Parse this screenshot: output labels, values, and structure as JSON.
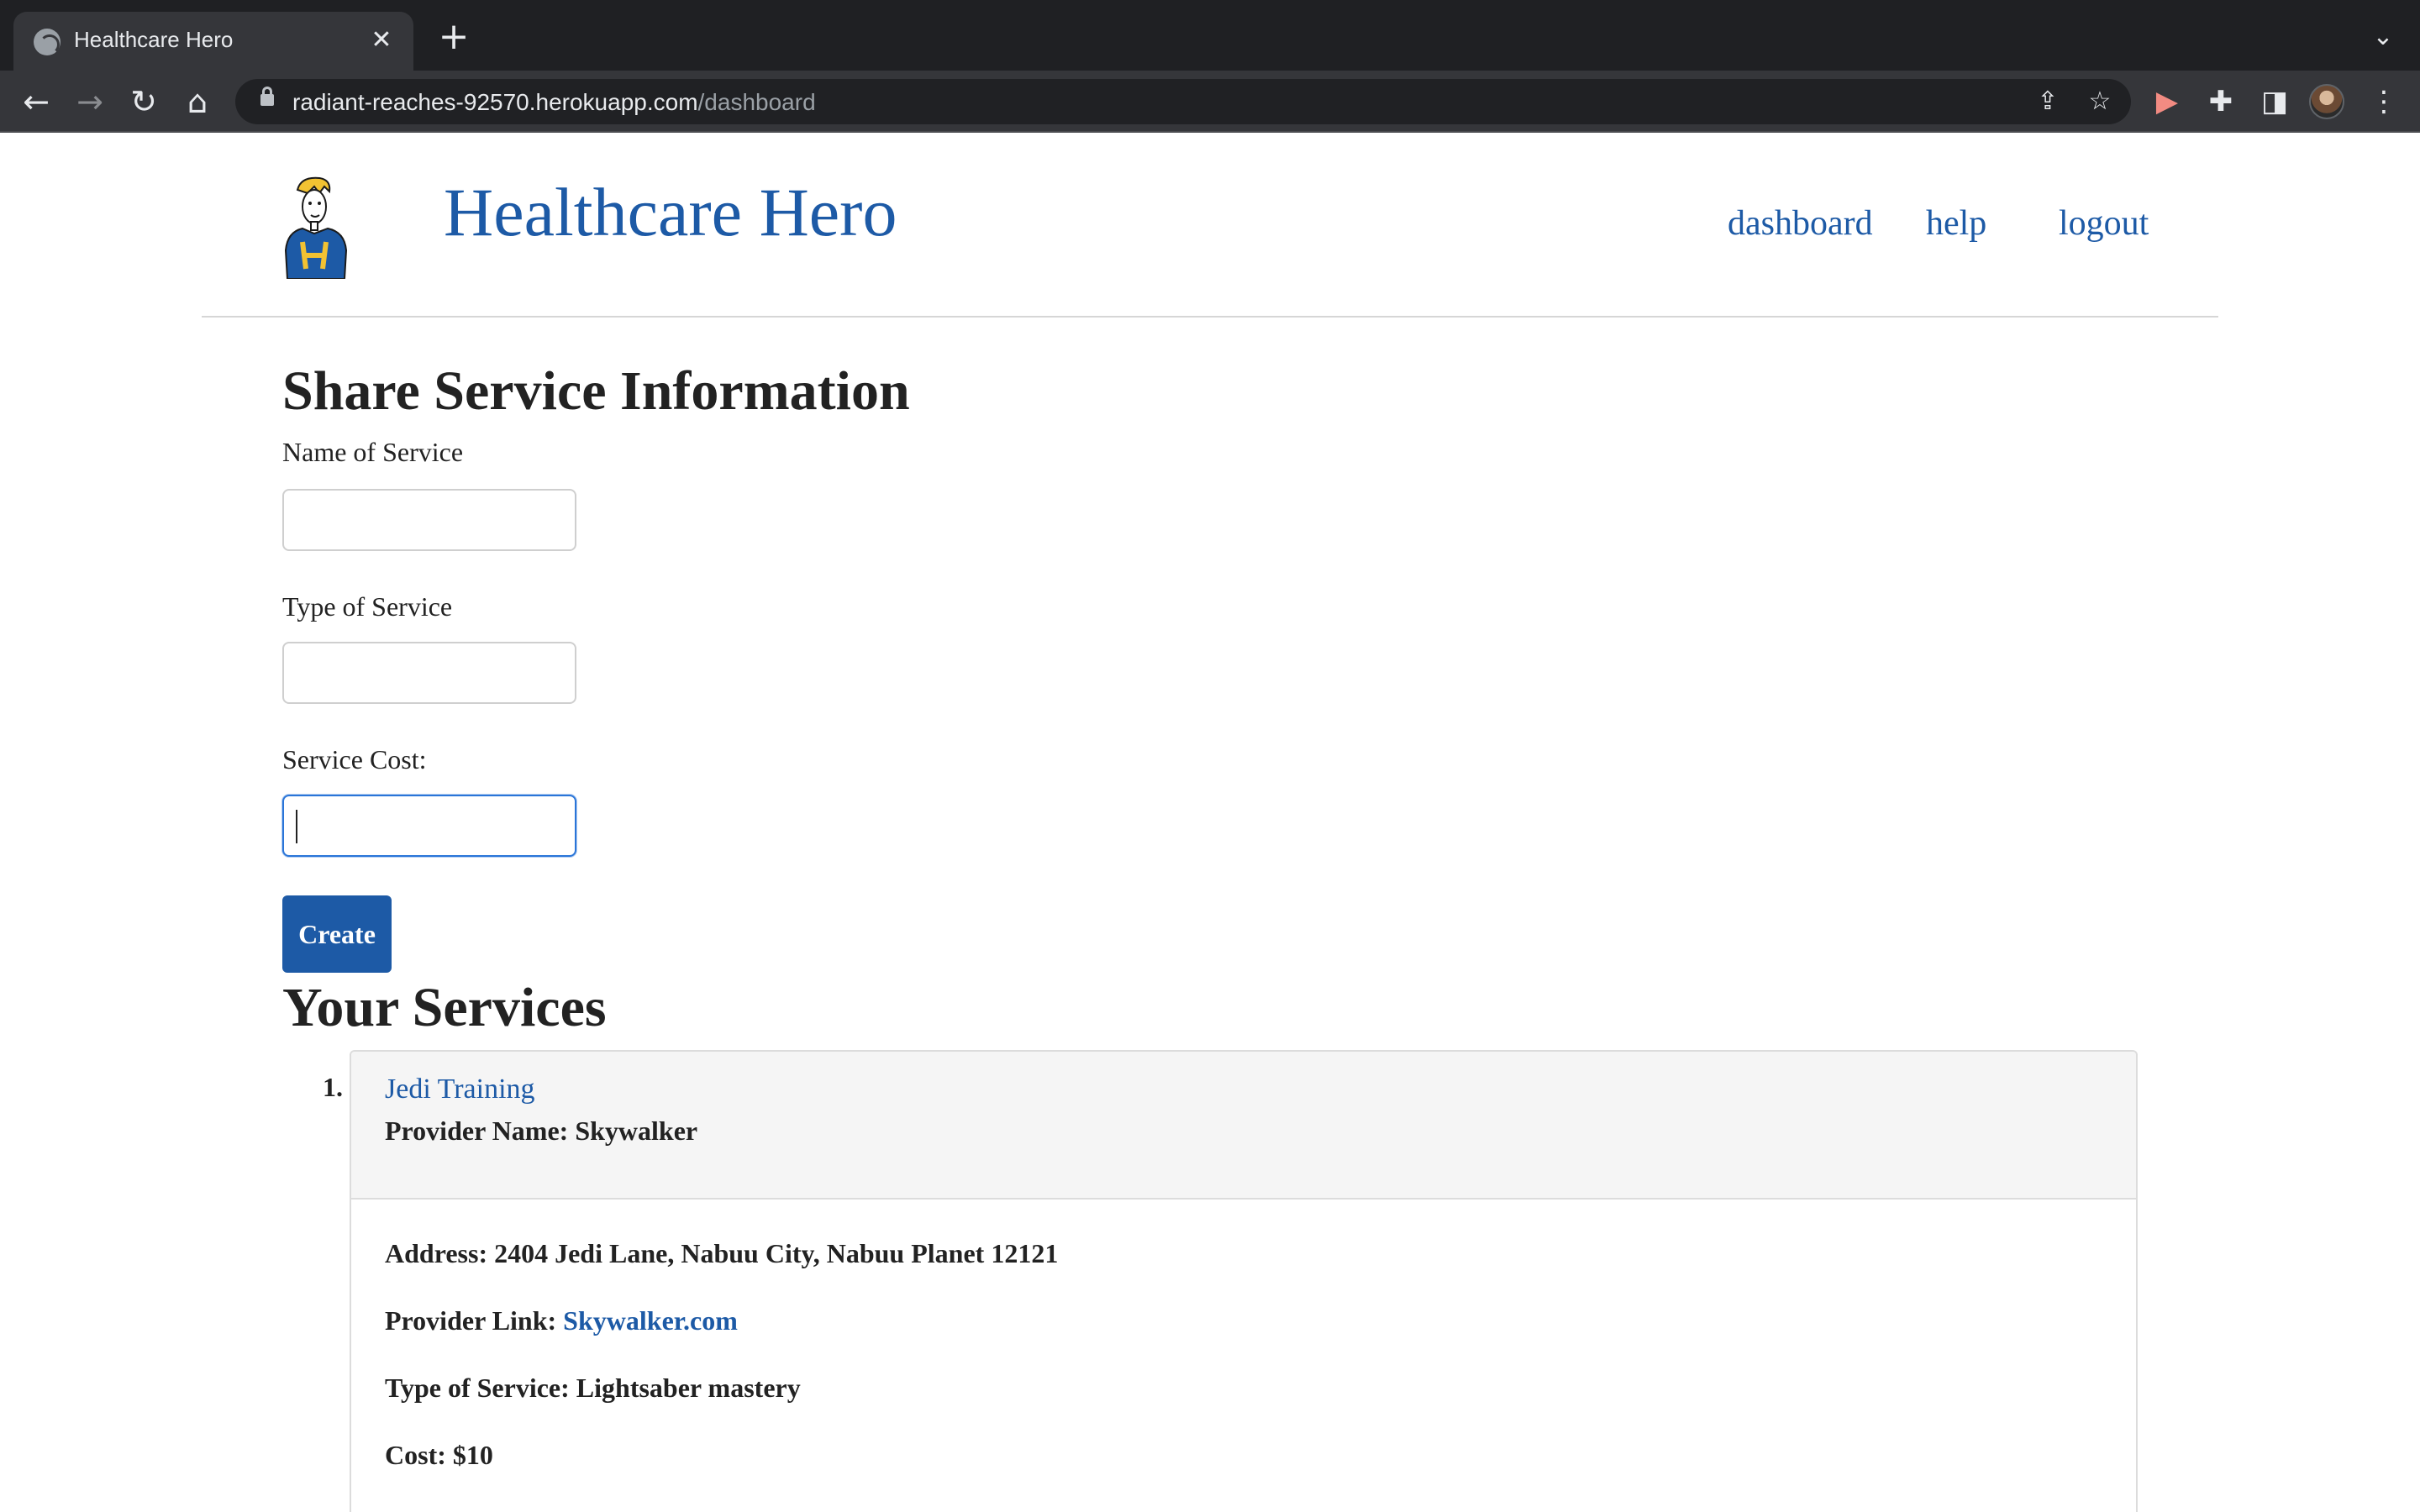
{
  "browser": {
    "tab_title": "Healthcare Hero",
    "close_glyph": "✕",
    "new_tab_glyph": "+",
    "tab_search_glyph": "⌄",
    "url_host": "radiant-reaches-92570.herokuapp.com",
    "url_path": "/dashboard",
    "back_glyph": "←",
    "forward_glyph": "→",
    "reload_glyph": "↻",
    "home_glyph": "⌂",
    "share_glyph": "⇪",
    "star_glyph": "☆",
    "extension_glyph": "✚",
    "sidepanel_glyph": "◨",
    "menu_glyph": "⋮",
    "cast_glyph": "▶"
  },
  "site": {
    "title": "Healthcare Hero",
    "nav": [
      {
        "label": "dashboard"
      },
      {
        "label": "help"
      },
      {
        "label": "logout"
      }
    ]
  },
  "form": {
    "title": "Share Service Information",
    "fields": [
      {
        "label": "Name of Service",
        "value": ""
      },
      {
        "label": "Type of Service",
        "value": ""
      },
      {
        "label": "Service Cost:",
        "value": ""
      }
    ],
    "submit_label": "Create"
  },
  "services": {
    "title": "Your Services",
    "items": [
      {
        "number": "1.",
        "name": "Jedi Training",
        "provider_label": "Provider Name:",
        "provider_name": "Skywalker",
        "address_label": "Address:",
        "address": "2404 Jedi Lane, Nabuu City, Nabuu Planet 12121",
        "link_label": "Provider Link:",
        "link_text": "Skywalker.com",
        "type_label": "Type of Service:",
        "type": "Lightsaber mastery",
        "cost_label": "Cost:",
        "cost": "$10"
      }
    ]
  },
  "colors": {
    "brand": "#1d5aa6",
    "chrome_dark": "#1f2023",
    "chrome_toolbar": "#35363a"
  }
}
